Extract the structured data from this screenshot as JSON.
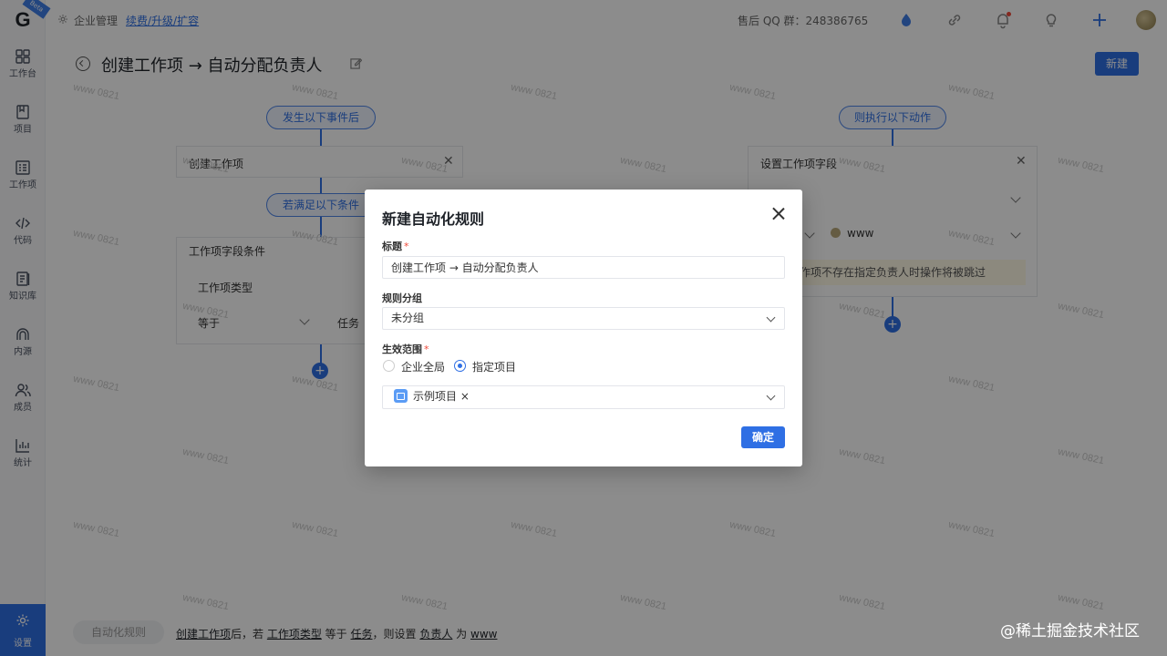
{
  "sidebar": {
    "logo": "G",
    "badge": "Beta",
    "items": [
      {
        "label": "工作台",
        "icon": "dashboard-icon"
      },
      {
        "label": "项目",
        "icon": "project-icon"
      },
      {
        "label": "工作项",
        "icon": "workitem-icon"
      },
      {
        "label": "代码",
        "icon": "code-icon"
      },
      {
        "label": "知识库",
        "icon": "knowledge-icon"
      },
      {
        "label": "内源",
        "icon": "innersource-icon"
      },
      {
        "label": "成员",
        "icon": "members-icon"
      },
      {
        "label": "统计",
        "icon": "stats-icon"
      }
    ],
    "settings_label": "设置"
  },
  "topbar": {
    "org_label": "企业管理",
    "renew_link": "续费/升级/扩容",
    "qq_group": "售后 QQ 群：248386765"
  },
  "page": {
    "title": "创建工作项 → 自动分配负责人",
    "new_button": "新建"
  },
  "flow": {
    "trigger_pill": "发生以下事件后",
    "trigger_card_title": "创建工作项",
    "condition_pill": "若满足以下条件",
    "condition_card_title": "工作项字段条件",
    "condition_field": "工作项类型",
    "condition_op": "等于",
    "condition_value": "任务",
    "action_pill": "则执行以下动作",
    "action_card_title": "设置工作项字段",
    "action_user": "www",
    "action_warning": "作项不存在指定负责人时操作将被跳过"
  },
  "summary": {
    "tag": "自动化规则",
    "parts": [
      "创建工作项",
      "后，若 ",
      "工作项类型",
      " 等于 ",
      "任务",
      "，则设置 ",
      "负责人",
      " 为 ",
      "www"
    ]
  },
  "brand": "@稀土掘金技术社区",
  "watermark": "www 0821",
  "modal": {
    "title": "新建自动化规则",
    "title_label": "标题",
    "title_value": "创建工作项 → 自动分配负责人",
    "group_label": "规则分组",
    "group_value": "未分组",
    "scope_label": "生效范围",
    "scope_options": [
      "企业全局",
      "指定项目"
    ],
    "scope_selected": "指定项目",
    "project_tag": "示例项目",
    "confirm_button": "确定"
  },
  "colors": {
    "primary": "#2f6fe4",
    "required": "#f04a3a"
  }
}
